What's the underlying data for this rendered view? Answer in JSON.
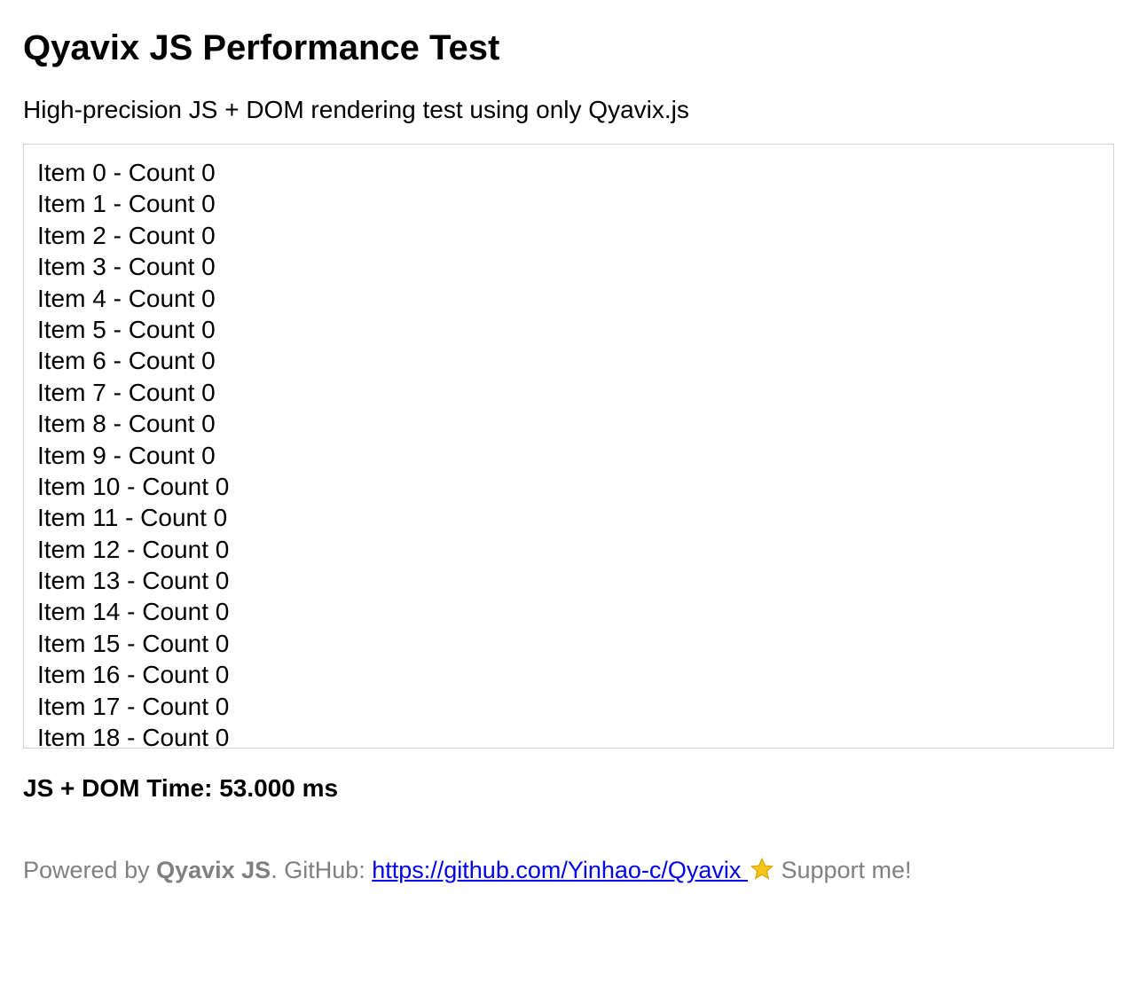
{
  "page": {
    "title": "Qyavix JS Performance Test",
    "subtitle": "High-precision JS + DOM rendering test using only Qyavix.js"
  },
  "list": {
    "items": [
      "Item 0 - Count 0",
      "Item 1 - Count 0",
      "Item 2 - Count 0",
      "Item 3 - Count 0",
      "Item 4 - Count 0",
      "Item 5 - Count 0",
      "Item 6 - Count 0",
      "Item 7 - Count 0",
      "Item 8 - Count 0",
      "Item 9 - Count 0",
      "Item 10 - Count 0",
      "Item 11 - Count 0",
      "Item 12 - Count 0",
      "Item 13 - Count 0",
      "Item 14 - Count 0",
      "Item 15 - Count 0",
      "Item 16 - Count 0",
      "Item 17 - Count 0",
      "Item 18 - Count 0"
    ]
  },
  "timing": {
    "text": "JS + DOM Time: 53.000 ms"
  },
  "footer": {
    "powered_prefix": "Powered by ",
    "brand": "Qyavix JS",
    "github_prefix": ". GitHub: ",
    "link_text": "https://github.com/Yinhao-c/Qyavix ",
    "star_icon": "star-icon",
    "support_text": " Support me!",
    "star_color": "#f5c518"
  }
}
